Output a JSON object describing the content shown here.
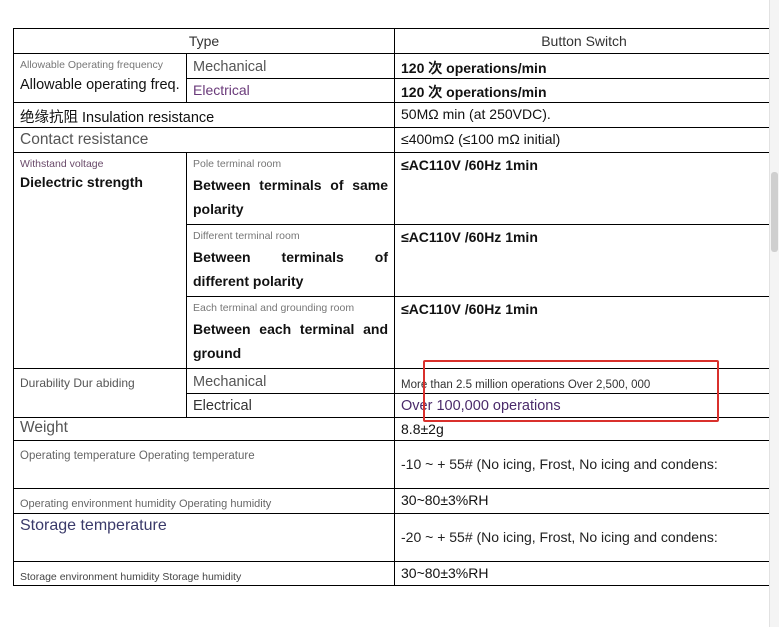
{
  "header": {
    "type": "Type",
    "button_switch": "Button Switch"
  },
  "rows": {
    "freq": {
      "small": "Allowable Operating frequency",
      "label": "Allowable operating freq.",
      "mechanical": "Mechanical",
      "electrical": "Electrical",
      "mech_value": "120 次 operations/min",
      "elec_value": "120 次 operations/min"
    },
    "insulation": {
      "label": "绝缘抗阻 Insulation resistance",
      "value": "50MΩ min (at 250VDC)."
    },
    "contact": {
      "label": "Contact resistance",
      "value": "≤400mΩ (≤100 mΩ initial)"
    },
    "dielectric": {
      "small": "Withstand voltage",
      "label": "Dielectric strength",
      "sub1_small": "Pole terminal room",
      "sub1_label": "Between terminals of same polarity",
      "sub1_value": "≤AC110V /60Hz 1min",
      "sub2_small": "Different terminal room",
      "sub2_label": "Between terminals of different polarity",
      "sub2_value": "≤AC110V /60Hz 1min",
      "sub3_small": "Each terminal and grounding room",
      "sub3_label": "Between each terminal and ground",
      "sub3_value": "≤AC110V /60Hz 1min"
    },
    "durability": {
      "label": "Durability Dur abiding",
      "mechanical": "Mechanical",
      "electrical": "Electrical",
      "mech_value": "More than 2.5 million operations Over 2,500, 000",
      "elec_value": "Over 100,000 operations"
    },
    "weight": {
      "label": "Weight",
      "value": "8.8±2g"
    },
    "op_temp": {
      "label": "Operating temperature Operating temperature",
      "value": "-10 ~ + 55# (No icing, Frost, No icing and condens:"
    },
    "op_humidity": {
      "label": "Operating environment humidity Operating humidity",
      "value": "30~80±3%RH"
    },
    "storage_temp": {
      "label": "Storage temperature",
      "value": "-20 ~ + 55# (No icing, Frost, No icing and condens:"
    },
    "storage_humidity": {
      "label": "Storage environment humidity Storage humidity",
      "value": "30~80±3%RH"
    }
  },
  "colors": {
    "highlight_border": "#d9302c",
    "grid": "#000000"
  }
}
